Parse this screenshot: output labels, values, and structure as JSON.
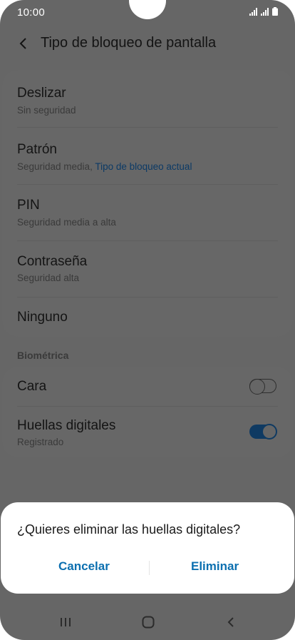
{
  "status": {
    "time": "10:00"
  },
  "header": {
    "title": "Tipo de bloqueo de pantalla"
  },
  "lock_types": [
    {
      "title": "Deslizar",
      "subtitle": "Sin seguridad"
    },
    {
      "title": "Patrón",
      "subtitle": "Seguridad media,",
      "subtitle_link": "Tipo de bloqueo actual"
    },
    {
      "title": "PIN",
      "subtitle": "Seguridad media a alta"
    },
    {
      "title": "Contraseña",
      "subtitle": "Seguridad alta"
    },
    {
      "title": "Ninguno"
    }
  ],
  "biometrics": {
    "section_label": "Biométrica",
    "items": [
      {
        "title": "Cara",
        "toggle_on": false
      },
      {
        "title": "Huellas digitales",
        "subtitle": "Registrado",
        "toggle_on": true
      }
    ]
  },
  "dialog": {
    "message": "¿Quieres eliminar las huellas digitales?",
    "cancel_label": "Cancelar",
    "confirm_label": "Eliminar"
  },
  "colors": {
    "accent": "#0b6fb0",
    "scrim_background": "#666666",
    "dialog_background": "#ffffff"
  }
}
